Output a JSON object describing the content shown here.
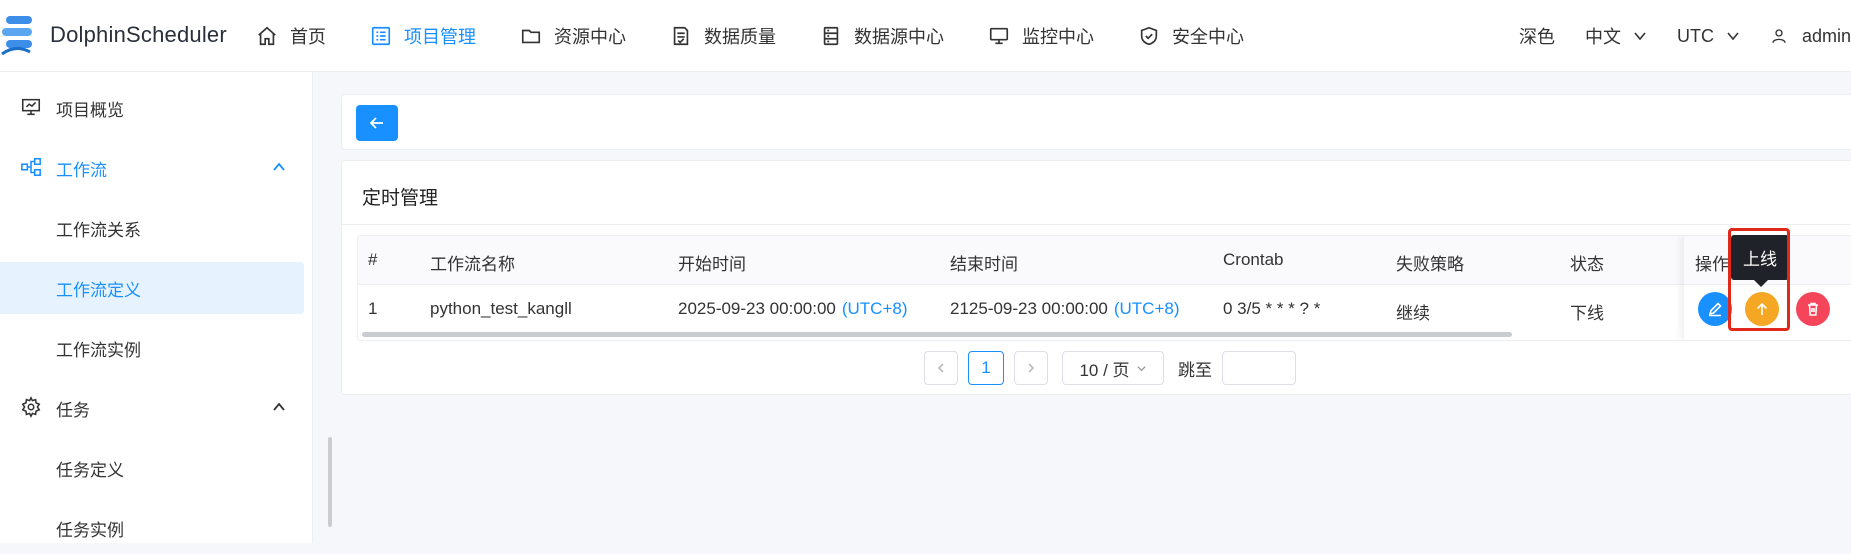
{
  "app": {
    "title": "DolphinScheduler",
    "accent": "#1890ff"
  },
  "nav": {
    "items": [
      {
        "label": "首页",
        "icon": "home-icon"
      },
      {
        "label": "项目管理",
        "icon": "project-list-icon",
        "active": true
      },
      {
        "label": "资源中心",
        "icon": "folder-icon"
      },
      {
        "label": "数据质量",
        "icon": "data-quality-icon"
      },
      {
        "label": "数据源中心",
        "icon": "datasource-icon"
      },
      {
        "label": "监控中心",
        "icon": "monitor-icon"
      },
      {
        "label": "安全中心",
        "icon": "shield-icon"
      }
    ],
    "theme": "深色",
    "language": "中文",
    "timezone": "UTC",
    "user": "admin"
  },
  "sidebar": {
    "items": [
      {
        "label": "项目概览",
        "icon": "overview-icon"
      },
      {
        "label": "工作流",
        "icon": "workflow-icon",
        "expanded": true
      },
      {
        "label": "工作流关系"
      },
      {
        "label": "工作流定义",
        "active": true
      },
      {
        "label": "工作流实例"
      },
      {
        "label": "任务",
        "icon": "gear-icon",
        "expanded": true
      },
      {
        "label": "任务定义"
      },
      {
        "label": "任务实例"
      }
    ]
  },
  "main": {
    "title": "定时管理",
    "table": {
      "headers": [
        "#",
        "工作流名称",
        "开始时间",
        "结束时间",
        "Crontab",
        "失败策略",
        "状态",
        "操作"
      ],
      "rows": [
        {
          "index": "1",
          "workflow_name": "python_test_kangll",
          "start_time": "2025-09-23 00:00:00",
          "start_tz": "(UTC+8)",
          "end_time": "2125-09-23 00:00:00",
          "end_tz": "(UTC+8)",
          "crontab": "0 3/5 * * * ? *",
          "failure_strategy": "继续",
          "status": "下线"
        }
      ]
    },
    "tooltip": "上线",
    "pagination": {
      "current_page": "1",
      "page_size": "10 / 页",
      "jump_label": "跳至",
      "jump_value": ""
    }
  },
  "colors": {
    "edit": "#1890ff",
    "online": "#f5a623",
    "delete": "#f5455a",
    "highlight": "#e0281b"
  }
}
